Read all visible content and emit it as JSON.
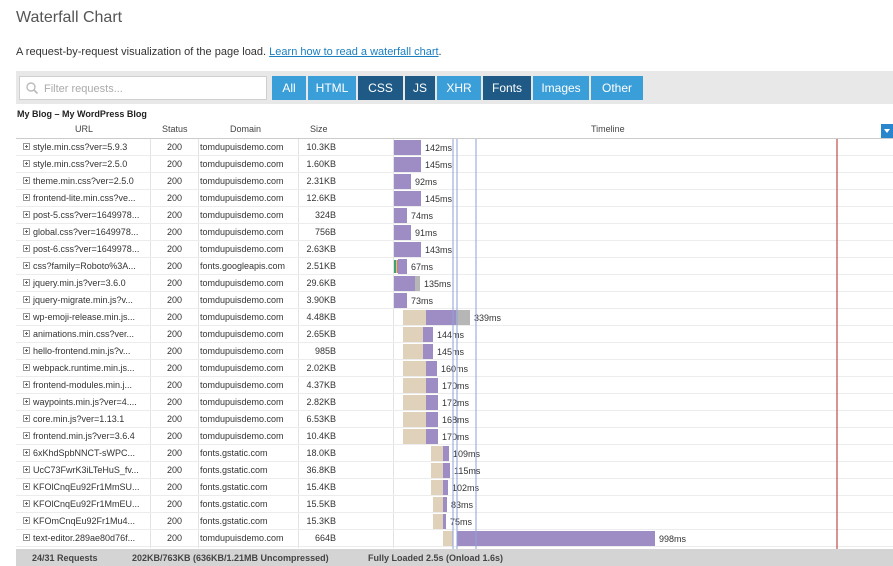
{
  "page": {
    "title": "Waterfall Chart",
    "description": "A request-by-request visualization of the page load.",
    "help_link": "Learn how to read a waterfall chart"
  },
  "filter": {
    "placeholder": "Filter requests...",
    "value": ""
  },
  "filter_buttons": [
    {
      "label": "All",
      "color": "#3a9ed8"
    },
    {
      "label": "HTML",
      "color": "#3a9ed8"
    },
    {
      "label": "CSS",
      "color": "#1e5a85"
    },
    {
      "label": "JS",
      "color": "#1e5a85"
    },
    {
      "label": "XHR",
      "color": "#3a9ed8"
    },
    {
      "label": "Fonts",
      "color": "#1e5a85"
    },
    {
      "label": "Images",
      "color": "#3a9ed8"
    },
    {
      "label": "Other",
      "color": "#3a9ed8"
    }
  ],
  "page_name": "My Blog – My WordPress Blog",
  "columns": {
    "url": "URL",
    "status": "Status",
    "domain": "Domain",
    "size": "Size",
    "timeline": "Timeline"
  },
  "colors": {
    "wait": "#e0d2ba",
    "receive": "#9e8dc4",
    "fade": "#b6b6b6",
    "dns": "#3ba36b",
    "ssl": "#b87ac2",
    "connect": "#f0c24a",
    "marker_blue": "#8ea2d8",
    "marker_red": "#b02a2a"
  },
  "requests": [
    {
      "url": "style.min.css?ver=5.9.3",
      "status": "200",
      "domain": "tomdupuisdemo.com",
      "size": "10.3KB",
      "time": "142ms"
    },
    {
      "url": "style.min.css?ver=2.5.0",
      "status": "200",
      "domain": "tomdupuisdemo.com",
      "size": "1.60KB",
      "time": "145ms"
    },
    {
      "url": "theme.min.css?ver=2.5.0",
      "status": "200",
      "domain": "tomdupuisdemo.com",
      "size": "2.31KB",
      "time": "92ms"
    },
    {
      "url": "frontend-lite.min.css?ve...",
      "status": "200",
      "domain": "tomdupuisdemo.com",
      "size": "12.6KB",
      "time": "145ms"
    },
    {
      "url": "post-5.css?ver=1649978...",
      "status": "200",
      "domain": "tomdupuisdemo.com",
      "size": "324B",
      "time": "74ms"
    },
    {
      "url": "global.css?ver=1649978...",
      "status": "200",
      "domain": "tomdupuisdemo.com",
      "size": "756B",
      "time": "91ms"
    },
    {
      "url": "post-6.css?ver=1649978...",
      "status": "200",
      "domain": "tomdupuisdemo.com",
      "size": "2.63KB",
      "time": "143ms"
    },
    {
      "url": "css?family=Roboto%3A...",
      "status": "200",
      "domain": "fonts.googleapis.com",
      "size": "2.51KB",
      "time": "67ms"
    },
    {
      "url": "jquery.min.js?ver=3.6.0",
      "status": "200",
      "domain": "tomdupuisdemo.com",
      "size": "29.6KB",
      "time": "135ms"
    },
    {
      "url": "jquery-migrate.min.js?v...",
      "status": "200",
      "domain": "tomdupuisdemo.com",
      "size": "3.90KB",
      "time": "73ms"
    },
    {
      "url": "wp-emoji-release.min.js...",
      "status": "200",
      "domain": "tomdupuisdemo.com",
      "size": "4.48KB",
      "time": "339ms"
    },
    {
      "url": "animations.min.css?ver...",
      "status": "200",
      "domain": "tomdupuisdemo.com",
      "size": "2.65KB",
      "time": "144ms"
    },
    {
      "url": "hello-frontend.min.js?v...",
      "status": "200",
      "domain": "tomdupuisdemo.com",
      "size": "985B",
      "time": "145ms"
    },
    {
      "url": "webpack.runtime.min.js...",
      "status": "200",
      "domain": "tomdupuisdemo.com",
      "size": "2.02KB",
      "time": "160ms"
    },
    {
      "url": "frontend-modules.min.j...",
      "status": "200",
      "domain": "tomdupuisdemo.com",
      "size": "4.37KB",
      "time": "170ms"
    },
    {
      "url": "waypoints.min.js?ver=4....",
      "status": "200",
      "domain": "tomdupuisdemo.com",
      "size": "2.82KB",
      "time": "172ms"
    },
    {
      "url": "core.min.js?ver=1.13.1",
      "status": "200",
      "domain": "tomdupuisdemo.com",
      "size": "6.53KB",
      "time": "168ms"
    },
    {
      "url": "frontend.min.js?ver=3.6.4",
      "status": "200",
      "domain": "tomdupuisdemo.com",
      "size": "10.4KB",
      "time": "170ms"
    },
    {
      "url": "6xKhdSpbNNCT-sWPC...",
      "status": "200",
      "domain": "fonts.gstatic.com",
      "size": "18.0KB",
      "time": "109ms"
    },
    {
      "url": "UcC73FwrK3iLTeHuS_fv...",
      "status": "200",
      "domain": "fonts.gstatic.com",
      "size": "36.8KB",
      "time": "115ms"
    },
    {
      "url": "KFOlCnqEu92Fr1MmSU...",
      "status": "200",
      "domain": "fonts.gstatic.com",
      "size": "15.4KB",
      "time": "102ms"
    },
    {
      "url": "KFOlCnqEu92Fr1MmEU...",
      "status": "200",
      "domain": "fonts.gstatic.com",
      "size": "15.5KB",
      "time": "83ms"
    },
    {
      "url": "KFOmCnqEu92Fr1Mu4...",
      "status": "200",
      "domain": "fonts.gstatic.com",
      "size": "15.3KB",
      "time": "75ms"
    },
    {
      "url": "text-editor.289ae80d76f...",
      "status": "200",
      "domain": "tomdupuisdemo.com",
      "size": "664B",
      "time": "998ms"
    }
  ],
  "footer": {
    "requests": "24/31 Requests",
    "size": "202KB/763KB  (636KB/1.21MB Uncompressed)",
    "loaded": "Fully Loaded 2.5s  (Onload 1.6s)"
  }
}
